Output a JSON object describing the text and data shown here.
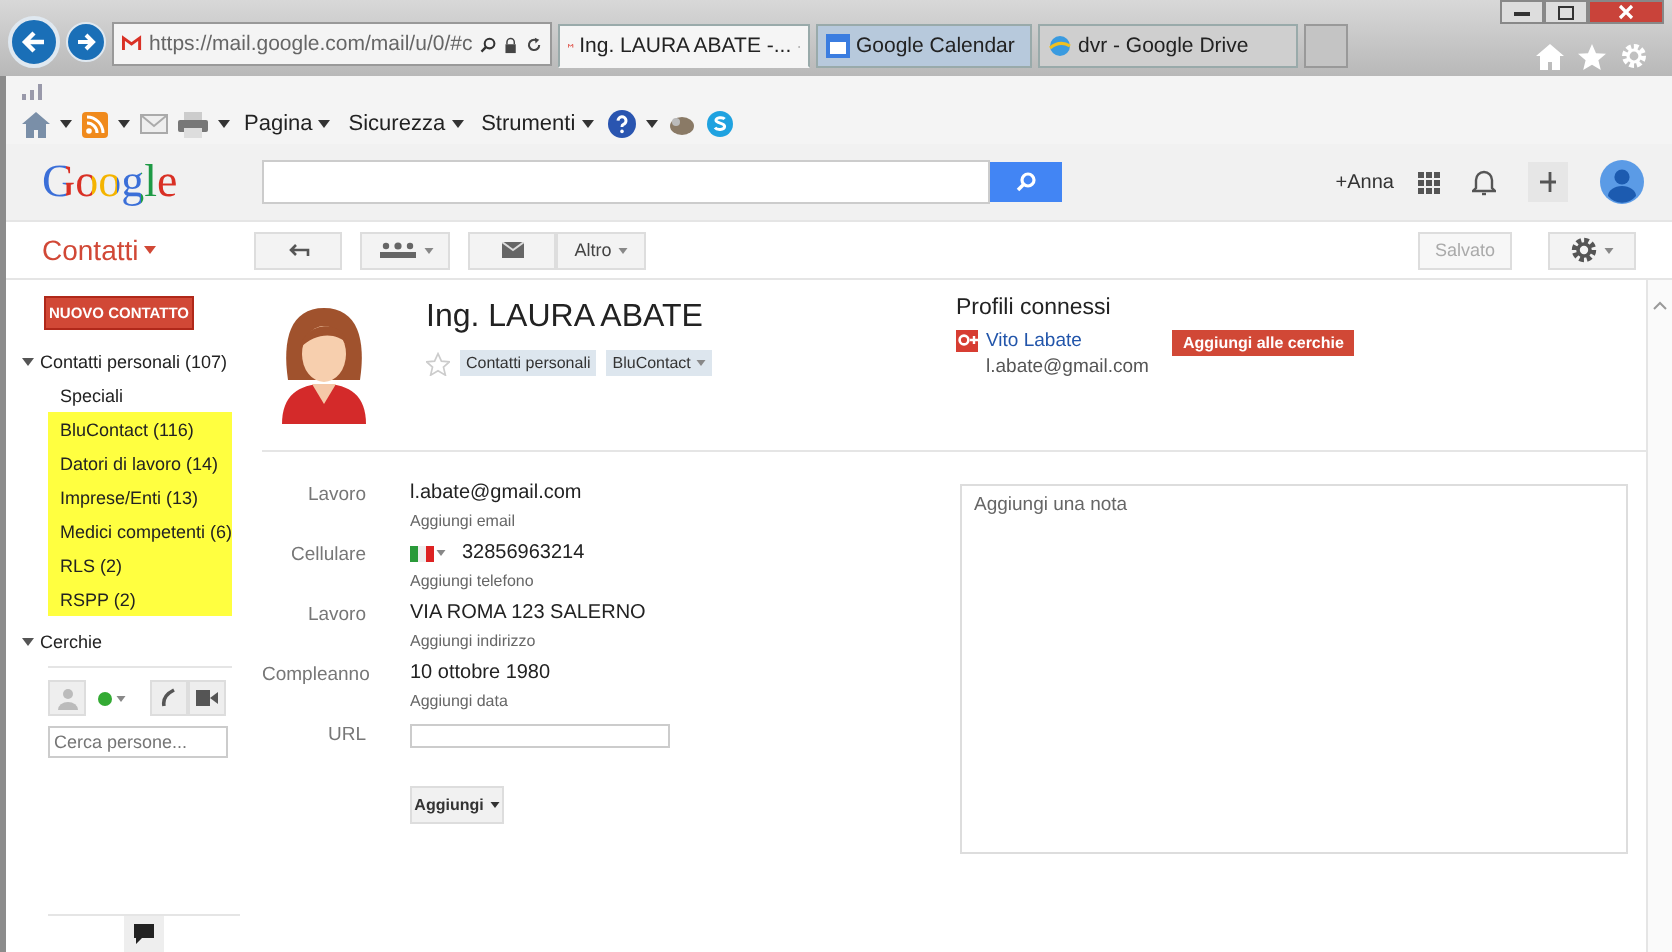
{
  "browser": {
    "address": "https://mail.google.com/mail/u/0/#c",
    "tabs": [
      {
        "title": "Ing. LAURA ABATE -...",
        "selected": true,
        "kind": "mail"
      },
      {
        "title": "Google Calendar",
        "selected": false,
        "kind": "calendar"
      },
      {
        "title": "dvr - Google Drive",
        "selected": false,
        "kind": "globe"
      }
    ],
    "menus": [
      "Pagina",
      "Sicurezza",
      "Strumenti"
    ]
  },
  "header": {
    "logo": "Google",
    "user": "+Anna"
  },
  "actionbar": {
    "app": "Contatti",
    "more": "Altro",
    "saved": {
      "label": "Salvato",
      "disabled": true
    }
  },
  "sidebar": {
    "new_button": "NUOVO CONTATTO",
    "groups": [
      {
        "label": "Contatti personali (107)",
        "expanded": true,
        "children": [
          {
            "label": "Speciali",
            "highlighted": false
          },
          {
            "label": "BluContact (116)",
            "highlighted": true
          },
          {
            "label": "Datori di lavoro (14)",
            "highlighted": true
          },
          {
            "label": "Imprese/Enti (13)",
            "highlighted": true
          },
          {
            "label": "Medici competenti (6)",
            "highlighted": true
          },
          {
            "label": "RLS (2)",
            "highlighted": true
          },
          {
            "label": "RSPP (2)",
            "highlighted": true
          }
        ]
      },
      {
        "label": "Cerchie",
        "expanded": true
      }
    ],
    "search_placeholder": "Cerca persone..."
  },
  "contact": {
    "name": "Ing. LAURA ABATE",
    "starred": false,
    "tags": [
      {
        "label": "Contatti personali",
        "dropdown": false
      },
      {
        "label": "BluContact",
        "dropdown": true
      }
    ],
    "fields": [
      {
        "label": "Lavoro",
        "kind": "text",
        "value": "l.abate@gmail.com",
        "add": "Aggiungi email"
      },
      {
        "label": "Cellulare",
        "kind": "phone",
        "value": "32856963214",
        "add": "Aggiungi telefono"
      },
      {
        "label": "Lavoro",
        "kind": "text",
        "value": "VIA ROMA 123 SALERNO",
        "add": "Aggiungi indirizzo"
      },
      {
        "label": "Compleanno",
        "kind": "text",
        "value": "10 ottobre 1980",
        "add": "Aggiungi data"
      },
      {
        "label": "URL",
        "kind": "input"
      }
    ],
    "add_button": "Aggiungi"
  },
  "profiles": {
    "title": "Profili connessi",
    "items": [
      {
        "name": "Vito Labate",
        "email": "l.abate@gmail.com",
        "action": "Aggiungi alle cerchie"
      }
    ]
  },
  "note": {
    "placeholder": "Aggiungi una nota"
  }
}
